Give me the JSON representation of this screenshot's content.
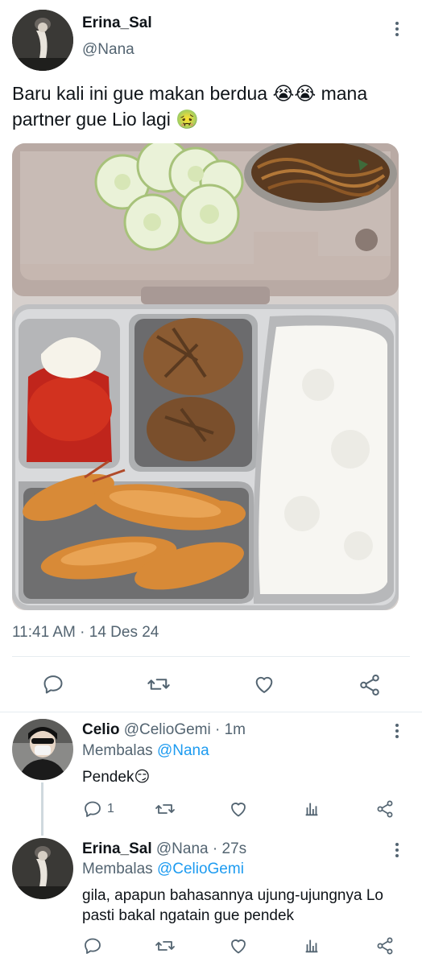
{
  "main_tweet": {
    "name": "Erina_Sal",
    "handle": "@Nana",
    "text": "Baru kali ini gue makan berdua 😭😭 mana partner gue Lio lagi 🤢",
    "timestamp": "11:41 AM · 14 Des 24",
    "actions": [
      "reply-icon",
      "retweet-icon",
      "like-icon",
      "share-icon"
    ]
  },
  "replies": [
    {
      "name": "Celio",
      "handle": "@CelioGemi",
      "time": "· 1m",
      "replying_label": "Membalas",
      "replying_to": "@Nana",
      "text": "Pendek😏",
      "reply_count": "1"
    },
    {
      "name": "Erina_Sal",
      "handle": "@Nana",
      "time": "· 27s",
      "replying_label": "Membalas",
      "replying_to": "@CelioGemi",
      "text": "gila,  apapun bahasannya ujung-ujungnya Lo pasti bakal ngatain gue pendek",
      "reply_count": ""
    }
  ],
  "colors": {
    "link": "#1d9bf0",
    "secondary_text": "#536471",
    "icon": "#536471"
  }
}
